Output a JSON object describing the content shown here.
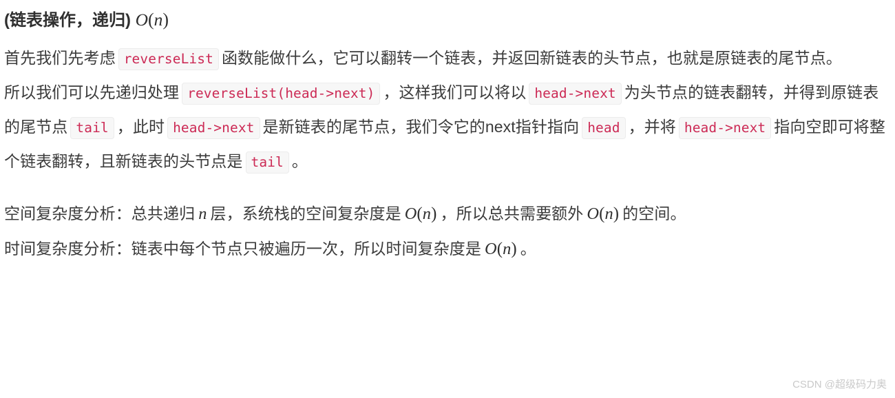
{
  "document": {
    "heading": {
      "prefix": "(链表操作，递归)",
      "math": "O(n)"
    },
    "paragraphs": [
      {
        "id": "p1",
        "segments": [
          {
            "type": "text",
            "value": "首先我们先考虑"
          },
          {
            "type": "code",
            "value": "reverseList"
          },
          {
            "type": "text",
            "value": "函数能做什么，它可以翻转一个链表，并返回新链表的头节点，也就是原链表的尾节点。"
          }
        ]
      },
      {
        "id": "p2",
        "segments": [
          {
            "type": "text",
            "value": "所以我们可以先递归处理"
          },
          {
            "type": "code",
            "value": "reverseList(head->next)"
          },
          {
            "type": "text",
            "value": "，这样我们可以将以"
          },
          {
            "type": "code",
            "value": "head->next"
          },
          {
            "type": "text",
            "value": "为头节点的链表翻转，并得到原链表的尾节点"
          },
          {
            "type": "code",
            "value": "tail"
          },
          {
            "type": "text",
            "value": "，此时"
          },
          {
            "type": "code",
            "value": "head->next"
          },
          {
            "type": "text",
            "value": "是新链表的尾节点，我们令它的next指针指向"
          },
          {
            "type": "code",
            "value": "head"
          },
          {
            "type": "text",
            "value": "，并将"
          },
          {
            "type": "code",
            "value": "head->next"
          },
          {
            "type": "text",
            "value": "指向空即可将整个链表翻转，且新链表的头节点是"
          },
          {
            "type": "code",
            "value": "tail"
          },
          {
            "type": "text",
            "value": "。"
          }
        ]
      },
      {
        "id": "p3",
        "segments": [
          {
            "type": "text",
            "value": "空间复杂度分析：总共递归"
          },
          {
            "type": "math",
            "value": "n"
          },
          {
            "type": "text",
            "value": "层，系统栈的空间复杂度是"
          },
          {
            "type": "math",
            "value": "O(n)"
          },
          {
            "type": "text",
            "value": "，所以总共需要额外"
          },
          {
            "type": "math",
            "value": "O(n)"
          },
          {
            "type": "text",
            "value": "的空间。"
          }
        ]
      },
      {
        "id": "p4",
        "segments": [
          {
            "type": "text",
            "value": "时间复杂度分析：链表中每个节点只被遍历一次，所以时间复杂度是"
          },
          {
            "type": "math",
            "value": "O(n)"
          },
          {
            "type": "text",
            "value": "。"
          }
        ]
      }
    ],
    "watermark": "CSDN @超级码力奥",
    "colors": {
      "code_text": "#cc2a55",
      "code_background": "#f7f7f7",
      "code_border": "#ececec",
      "body_text": "#3b3b3b",
      "heading_text": "#2f2f2f",
      "watermark_text": "#c9c9c9",
      "page_background": "#ffffff"
    }
  }
}
